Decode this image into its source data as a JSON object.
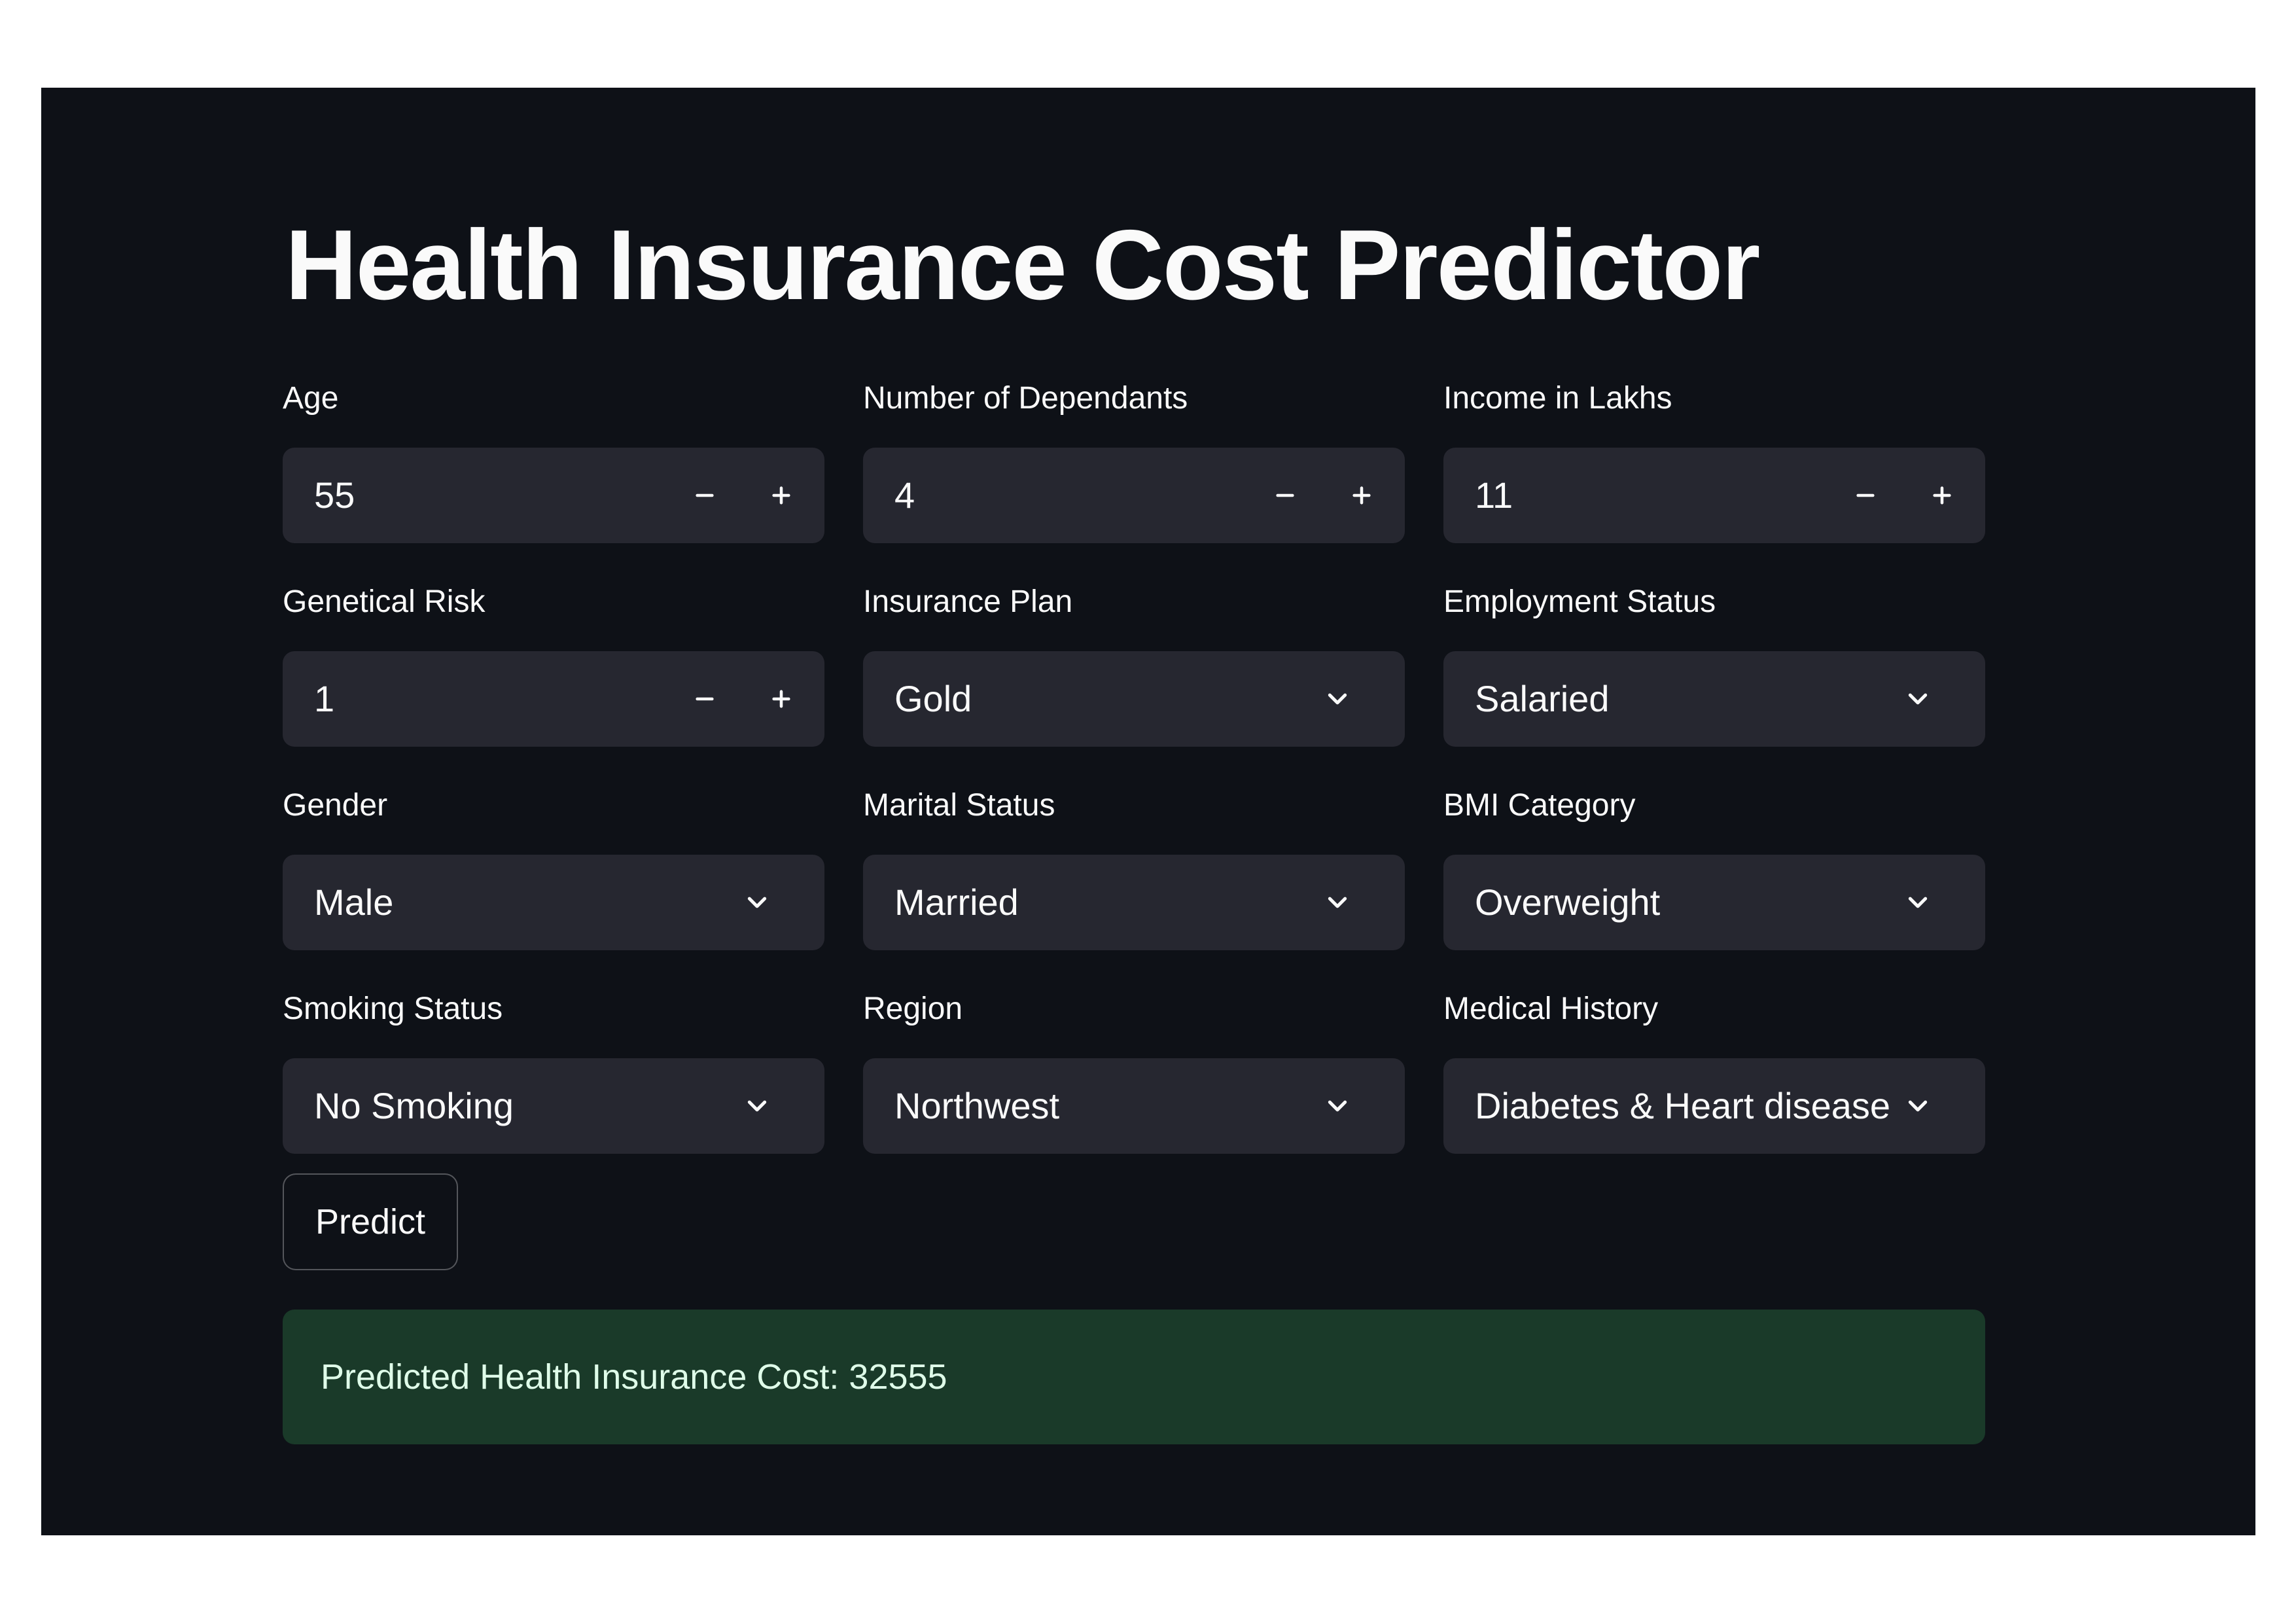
{
  "title": "Health Insurance Cost Predictor",
  "fields": [
    {
      "label": "Age",
      "kind": "number",
      "value": "55"
    },
    {
      "label": "Number of Dependants",
      "kind": "number",
      "value": "4"
    },
    {
      "label": "Income in Lakhs",
      "kind": "number",
      "value": "11"
    },
    {
      "label": "Genetical Risk",
      "kind": "number",
      "value": "1"
    },
    {
      "label": "Insurance Plan",
      "kind": "select",
      "value": "Gold"
    },
    {
      "label": "Employment Status",
      "kind": "select",
      "value": "Salaried"
    },
    {
      "label": "Gender",
      "kind": "select",
      "value": "Male"
    },
    {
      "label": "Marital Status",
      "kind": "select",
      "value": "Married"
    },
    {
      "label": "BMI Category",
      "kind": "select",
      "value": "Overweight"
    },
    {
      "label": "Smoking Status",
      "kind": "select",
      "value": "No Smoking"
    },
    {
      "label": "Region",
      "kind": "select",
      "value": "Northwest"
    },
    {
      "label": "Medical History",
      "kind": "select",
      "value": "Diabetes & Heart disease"
    }
  ],
  "icons": {
    "decrement": "minus-icon",
    "increment": "plus-icon",
    "dropdown": "chevron-down-icon"
  },
  "predict_label": "Predict",
  "result_text": "Predicted Health Insurance Cost: 32555",
  "colors": {
    "app_background": "#0e1117",
    "control_background": "#262730",
    "text": "#fafafa",
    "success_background": "#1a3a29",
    "success_text": "#dffde9"
  }
}
